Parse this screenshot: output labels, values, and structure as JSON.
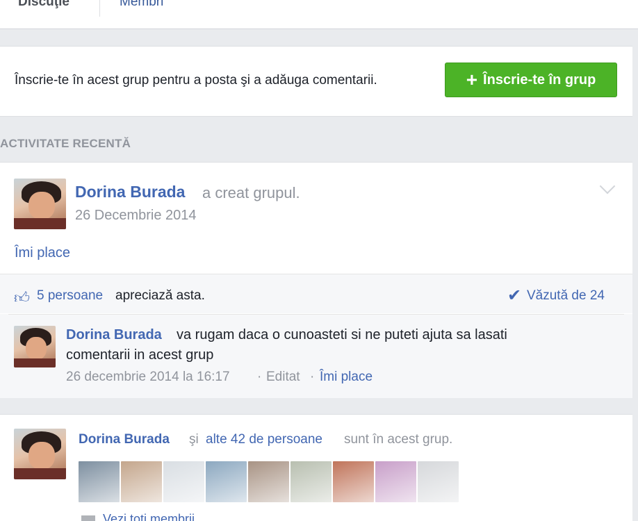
{
  "tabs": {
    "discussion": "Discuţie",
    "members": "Membri"
  },
  "join": {
    "prompt": "Înscrie-te în acest grup pentru a posta şi a adăuga comentarii.",
    "button_label": "Înscrie-te în grup",
    "button_icon": "plus-icon",
    "accent": "#4cb327"
  },
  "section_title": "ACTIVITATE RECENTĂ",
  "post": {
    "author": "Dorina Burada",
    "action": "a creat grupul.",
    "date": "26 Decembrie 2014",
    "like_link": "Îmi place",
    "likes_count": "5 persoane",
    "likes_text": "apreciază asta.",
    "seen": "Văzută de 24",
    "comment": {
      "author": "Dorina Burada",
      "text_line1": "va rugam daca o cunoasteti si ne puteti ajuta sa lasati",
      "text_line2": "comentarii in acest grup",
      "date": "26 decembrie 2014 la 16:17",
      "separator": "·",
      "edited": "Editat",
      "like_link": "Îmi place"
    }
  },
  "members": {
    "author": "Dorina Burada",
    "and": "şi",
    "others": "alte 42 de persoane",
    "tail": "sunt în acest grup.",
    "thumb_colors": [
      "#7d8fa0",
      "#c4a68c",
      "#d9dee3",
      "#8ca8c0",
      "#a89384",
      "#b8bfb0",
      "#c0745a",
      "#c89fc9",
      "#d6d8db"
    ],
    "bottom_text": "Vezi toţi membrii"
  },
  "colors": {
    "link": "#4267b2",
    "muted": "#90949c",
    "background": "#e9ebee"
  }
}
